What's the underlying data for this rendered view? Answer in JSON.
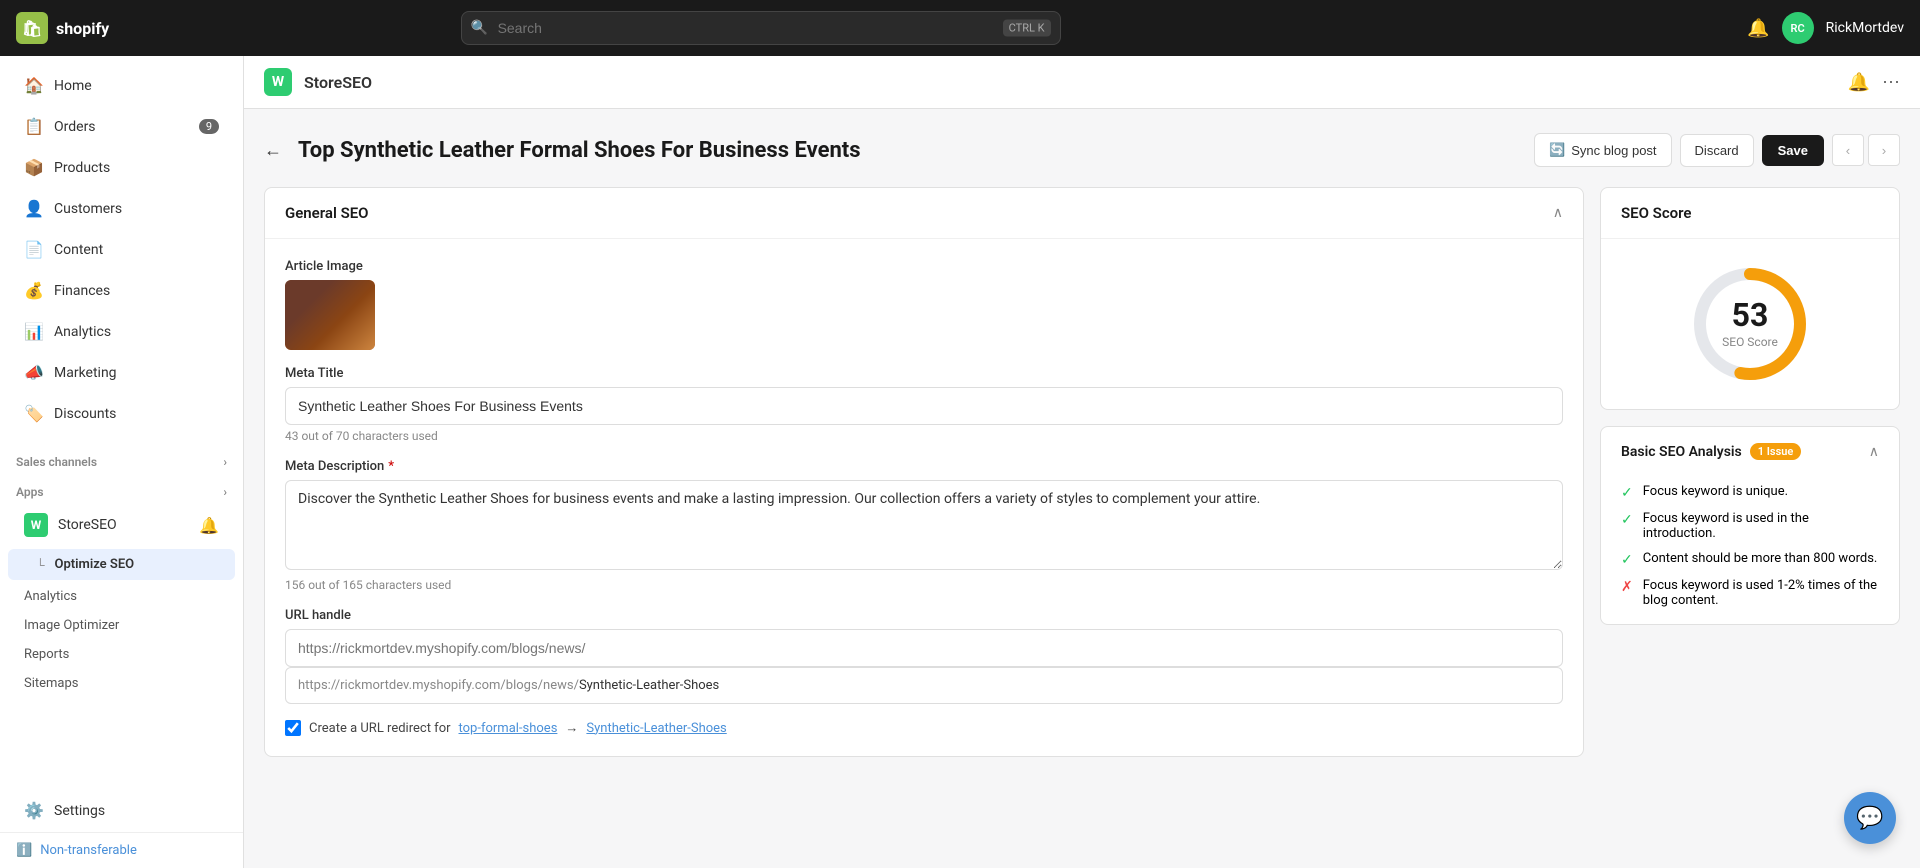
{
  "topbar": {
    "logo_text": "shopify",
    "search_placeholder": "Search",
    "search_shortcut1": "CTRL",
    "search_shortcut2": "K",
    "username": "RickMortdev"
  },
  "sidebar": {
    "items": [
      {
        "id": "home",
        "label": "Home",
        "icon": "🏠"
      },
      {
        "id": "orders",
        "label": "Orders",
        "icon": "📋",
        "badge": "9"
      },
      {
        "id": "products",
        "label": "Products",
        "icon": "📦"
      },
      {
        "id": "customers",
        "label": "Customers",
        "icon": "👤"
      },
      {
        "id": "content",
        "label": "Content",
        "icon": "📄"
      },
      {
        "id": "finances",
        "label": "Finances",
        "icon": "💰"
      },
      {
        "id": "analytics",
        "label": "Analytics",
        "icon": "📊"
      },
      {
        "id": "marketing",
        "label": "Marketing",
        "icon": "📣"
      },
      {
        "id": "discounts",
        "label": "Discounts",
        "icon": "🏷️"
      }
    ],
    "sales_channels_label": "Sales channels",
    "apps_label": "Apps",
    "app_name": "StoreSEO",
    "optimize_seo_label": "Optimize SEO",
    "sub_items": [
      {
        "id": "analytics",
        "label": "Analytics"
      },
      {
        "id": "image-optimizer",
        "label": "Image Optimizer"
      },
      {
        "id": "reports",
        "label": "Reports"
      },
      {
        "id": "sitemaps",
        "label": "Sitemaps"
      }
    ],
    "settings_label": "Settings",
    "non_transferable_label": "Non-transferable"
  },
  "app_header": {
    "app_name": "StoreSEO",
    "bell_icon": "🔔",
    "more_icon": "⋯"
  },
  "page": {
    "title": "Top Synthetic Leather Formal Shoes For Business Events",
    "sync_label": "Sync blog post",
    "discard_label": "Discard",
    "save_label": "Save"
  },
  "general_seo": {
    "section_title": "General SEO",
    "article_image_label": "Article Image",
    "meta_title_label": "Meta Title",
    "meta_title_value": "Synthetic Leather Shoes For Business Events",
    "meta_title_hint": "43 out of 70 characters used",
    "meta_description_label": "Meta Description",
    "meta_description_value": "Discover the Synthetic Leather Shoes for business events and make a lasting impression. Our collection offers a variety of styles to complement your attire.",
    "meta_description_hint": "156 out of 165 characters used",
    "url_handle_label": "URL handle",
    "url_prefix": "https://rickmortdev.myshopify.com/blogs/news/",
    "url_handle_value": "Synthetic-Leather-Shoes",
    "url_redirect_label": "Create a URL redirect for",
    "url_redirect_link1": "top-formal-shoes",
    "url_redirect_arrow": "→",
    "url_redirect_link2": "Synthetic-Leather-Shoes"
  },
  "seo_score": {
    "title": "SEO Score",
    "score": "53",
    "label": "SEO Score",
    "donut_value": 53,
    "donut_max": 100,
    "donut_color": "#f59e0b",
    "donut_bg": "#e5e7eb"
  },
  "basic_seo": {
    "title": "Basic SEO Analysis",
    "issue_badge": "1 Issue",
    "items": [
      {
        "status": "pass",
        "text": "Focus keyword is unique."
      },
      {
        "status": "pass",
        "text": "Focus keyword is used in the introduction."
      },
      {
        "status": "pass",
        "text": "Content should be more than 800 words."
      },
      {
        "status": "fail",
        "text": "Focus keyword is used 1-2% times of the blog content."
      }
    ]
  }
}
